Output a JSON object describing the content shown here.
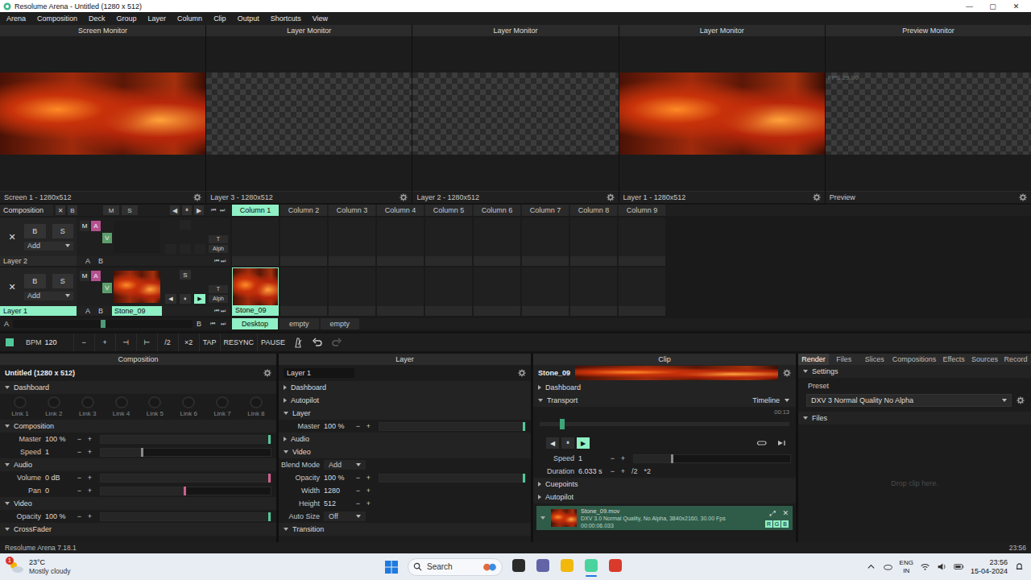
{
  "window": {
    "title": "Resolume Arena - Untitled (1280 x 512)",
    "controls": [
      "—",
      "▢",
      "✕"
    ]
  },
  "menu": [
    "Arena",
    "Composition",
    "Deck",
    "Group",
    "Layer",
    "Column",
    "Clip",
    "Output",
    "Shortcuts",
    "View"
  ],
  "monitors": [
    {
      "title": "Screen Monitor",
      "footer": "Screen 1 - 1280x512",
      "kind": "video",
      "overlay": ""
    },
    {
      "title": "Layer Monitor",
      "footer": "Layer 3 - 1280x512",
      "kind": "transparent",
      "overlay": ""
    },
    {
      "title": "Layer Monitor",
      "footer": "Layer 2 - 1280x512",
      "kind": "transparent",
      "overlay": ""
    },
    {
      "title": "Layer Monitor",
      "footer": "Layer 1 - 1280x512",
      "kind": "video",
      "overlay": ""
    },
    {
      "title": "Preview Monitor",
      "footer": "Preview",
      "kind": "transparent",
      "overlay": "FPS 29.90"
    }
  ],
  "stepper": [
    "−",
    "+"
  ],
  "deck": {
    "header": {
      "label": "Composition",
      "buttons": [
        "✕",
        "B"
      ],
      "ms": [
        "M",
        "S"
      ],
      "transport": [
        "◀",
        "⏸",
        "▶"
      ],
      "nav": [
        "⏮",
        "⏭"
      ]
    },
    "columns": [
      {
        "label": "Column 1",
        "selected": true
      },
      {
        "label": "Column 2",
        "selected": false
      },
      {
        "label": "Column 3",
        "selected": false
      },
      {
        "label": "Column 4",
        "selected": false
      },
      {
        "label": "Column 5",
        "selected": false
      },
      {
        "label": "Column 6",
        "selected": false
      },
      {
        "label": "Column 7",
        "selected": false
      },
      {
        "label": "Column 8",
        "selected": false
      },
      {
        "label": "Column 9",
        "selected": false
      }
    ],
    "layers": [
      {
        "name": "Layer 2",
        "selected": false,
        "active": false,
        "close": "✕",
        "buttons": [
          "B",
          "S"
        ],
        "blend": "Add",
        "toggles": [
          {
            "label": "M",
            "on": false,
            "color": "#3c3c3c"
          },
          {
            "label": "A",
            "on": true,
            "color": "#b5508f"
          },
          {
            "label": "V",
            "on": true,
            "color": "#5c9f6c"
          }
        ],
        "thumb": false,
        "thumb_label": "",
        "solo": "",
        "transport": [],
        "side": [
          "T",
          "Alph"
        ],
        "ab": [
          "A",
          "B"
        ],
        "nav": [
          "⏮",
          "⏭"
        ],
        "clips": [
          {
            "name": "",
            "filled": false,
            "selected": false
          },
          {
            "name": "",
            "filled": false,
            "selected": false
          },
          {
            "name": "",
            "filled": false,
            "selected": false
          },
          {
            "name": "",
            "filled": false,
            "selected": false
          },
          {
            "name": "",
            "filled": false,
            "selected": false
          },
          {
            "name": "",
            "filled": false,
            "selected": false
          },
          {
            "name": "",
            "filled": false,
            "selected": false
          },
          {
            "name": "",
            "filled": false,
            "selected": false
          },
          {
            "name": "",
            "filled": false,
            "selected": false
          }
        ]
      },
      {
        "name": "Layer 1",
        "selected": true,
        "active": true,
        "close": "✕",
        "buttons": [
          "B",
          "S"
        ],
        "blend": "Add",
        "toggles": [
          {
            "label": "M",
            "on": false,
            "color": "#3c3c3c"
          },
          {
            "label": "A",
            "on": true,
            "color": "#b5508f"
          },
          {
            "label": "V",
            "on": true,
            "color": "#5c9f6c"
          }
        ],
        "thumb": true,
        "thumb_label": "Stone_09",
        "solo": "S",
        "transport": [
          {
            "label": "◀",
            "on": false
          },
          {
            "label": "⏸",
            "on": false
          },
          {
            "label": "▶",
            "on": true
          }
        ],
        "side": [
          "T",
          "Alph"
        ],
        "ab": [
          "A",
          "B"
        ],
        "nav": [
          "⏮",
          "⏭"
        ],
        "clips": [
          {
            "name": "Stone_09",
            "filled": true,
            "selected": true
          },
          {
            "name": "",
            "filled": false,
            "selected": false
          },
          {
            "name": "",
            "filled": false,
            "selected": false
          },
          {
            "name": "",
            "filled": false,
            "selected": false
          },
          {
            "name": "",
            "filled": false,
            "selected": false
          },
          {
            "name": "",
            "filled": false,
            "selected": false
          },
          {
            "name": "",
            "filled": false,
            "selected": false
          },
          {
            "name": "",
            "filled": false,
            "selected": false
          },
          {
            "name": "",
            "filled": false,
            "selected": false
          }
        ]
      }
    ],
    "footer": {
      "a": "A",
      "b": "B",
      "level": 0.5,
      "nav": [
        "⏮",
        "⏭"
      ],
      "decks": [
        {
          "label": "Desktop",
          "selected": true
        },
        {
          "label": "empty",
          "selected": false
        },
        {
          "label": "empty",
          "selected": false
        }
      ]
    }
  },
  "bpm_bar": {
    "label": "BPM",
    "value": "120",
    "buttons": [
      "−",
      "+",
      "⊣",
      "⊢",
      "/2",
      "×2",
      "TAP",
      "RESYNC",
      "PAUSE"
    ],
    "redo_enabled": false
  },
  "composition_panel": {
    "header": "Composition",
    "name": "Untitled (1280 x 512)",
    "sections": [
      {
        "title": "Dashboard",
        "expanded": true,
        "links": [
          "Link 1",
          "Link 2",
          "Link 3",
          "Link 4",
          "Link 5",
          "Link 6",
          "Link 7",
          "Link 8"
        ],
        "rows": []
      },
      {
        "title": "Composition",
        "expanded": true,
        "rows": [
          {
            "label": "Master",
            "value": "100 %",
            "kind": "slider",
            "level": 1,
            "color": "#54c79a"
          },
          {
            "label": "Speed",
            "value": "1",
            "kind": "slider",
            "level": 0.25,
            "color": "#8a8a8a"
          }
        ]
      },
      {
        "title": "Audio",
        "expanded": true,
        "rows": [
          {
            "label": "Volume",
            "value": "0 dB",
            "kind": "slider",
            "level": 1,
            "color": "#d0608f"
          },
          {
            "label": "Pan",
            "value": "0",
            "kind": "slider",
            "level": 0.5,
            "color": "#d0608f"
          }
        ]
      },
      {
        "title": "Video",
        "expanded": true,
        "rows": [
          {
            "label": "Opacity",
            "value": "100 %",
            "kind": "slider",
            "level": 1,
            "color": "#54c79a"
          }
        ]
      },
      {
        "title": "CrossFader",
        "expanded": true,
        "rows": []
      }
    ]
  },
  "layer_panel": {
    "header": "Layer",
    "name": "Layer 1",
    "sections": [
      {
        "title": "Dashboard",
        "expanded": false,
        "rows": []
      },
      {
        "title": "Autopilot",
        "expanded": false,
        "rows": []
      },
      {
        "title": "Layer",
        "expanded": true,
        "rows": [
          {
            "label": "Master",
            "value": "100 %",
            "kind": "slider",
            "level": 1,
            "color": "#54c79a"
          }
        ]
      },
      {
        "title": "Audio",
        "expanded": false,
        "rows": []
      },
      {
        "title": "Video",
        "expanded": true,
        "rows": [
          {
            "label": "Blend Mode",
            "value": "Add",
            "kind": "dropdown"
          },
          {
            "label": "Opacity",
            "value": "100 %",
            "kind": "slider",
            "level": 1,
            "color": "#54c79a"
          },
          {
            "label": "Width",
            "value": "1280",
            "kind": "number"
          },
          {
            "label": "Height",
            "value": "512",
            "kind": "number"
          },
          {
            "label": "Auto Size",
            "value": "Off",
            "kind": "dropdown"
          }
        ]
      },
      {
        "title": "Transition",
        "expanded": true,
        "rows": []
      }
    ]
  },
  "clip_panel": {
    "header": "Clip",
    "name": "Stone_09",
    "sections": [
      {
        "title": "Dashboard",
        "expanded": false,
        "rows": []
      },
      {
        "title": "Transport",
        "expanded": true,
        "mode": "Timeline",
        "time": "00:13",
        "position": 0.09,
        "controls": [
          {
            "label": "◀",
            "on": false
          },
          {
            "label": "⏸",
            "on": false
          },
          {
            "label": "▶",
            "on": true
          }
        ],
        "rows": [
          {
            "label": "Speed",
            "value": "1",
            "kind": "slider",
            "level": 0.25,
            "color": "#8a8a8a"
          },
          {
            "label": "Duration",
            "value": "6.033 s",
            "kind": "number",
            "extra": [
              "/2",
              "*2"
            ]
          }
        ]
      },
      {
        "title": "Cuepoints",
        "expanded": false,
        "rows": []
      },
      {
        "title": "Autopilot",
        "expanded": false,
        "rows": []
      }
    ],
    "file": {
      "name": "Stone_09.mov",
      "info": "DXV 3.0 Normal Quality, No Alpha, 3840x2160, 30.00 Fps",
      "duration": "00:00:06.033",
      "actions": [
        "⤢",
        "✕"
      ],
      "channels": [
        {
          "label": "R",
          "on": true
        },
        {
          "label": "G",
          "on": true
        },
        {
          "label": "B",
          "on": true
        }
      ]
    }
  },
  "right_panel": {
    "tabs": [
      {
        "label": "Render",
        "selected": true
      },
      {
        "label": "Files",
        "selected": false
      },
      {
        "label": "Slices",
        "selected": false
      },
      {
        "label": "Compositions",
        "selected": false
      },
      {
        "label": "Effects",
        "selected": false
      },
      {
        "label": "Sources",
        "selected": false
      },
      {
        "label": "Record",
        "selected": false
      }
    ],
    "settings": {
      "title": "Settings",
      "expanded": true,
      "preset_label": "Preset",
      "preset": "DXV 3 Normal Quality No Alpha"
    },
    "files": {
      "title": "Files",
      "expanded": true,
      "hint": "Drop clip here."
    }
  },
  "status_bar": {
    "left": "Resolume Arena 7.18.1",
    "right": "23:56"
  },
  "taskbar": {
    "weather": {
      "temp": "23°C",
      "desc": "Mostly cloudy",
      "badge": "1"
    },
    "search": "Search",
    "apps": [
      {
        "color": "#2b2b2b",
        "active": false
      },
      {
        "color": "#6264a7",
        "active": false
      },
      {
        "color": "#f2b90c",
        "active": false
      },
      {
        "color": "#49d49e",
        "active": true
      },
      {
        "color": "#d93a2b",
        "active": false
      }
    ],
    "lang": [
      "ENG",
      "IN"
    ],
    "time": "23:56",
    "date": "15-04-2024"
  }
}
